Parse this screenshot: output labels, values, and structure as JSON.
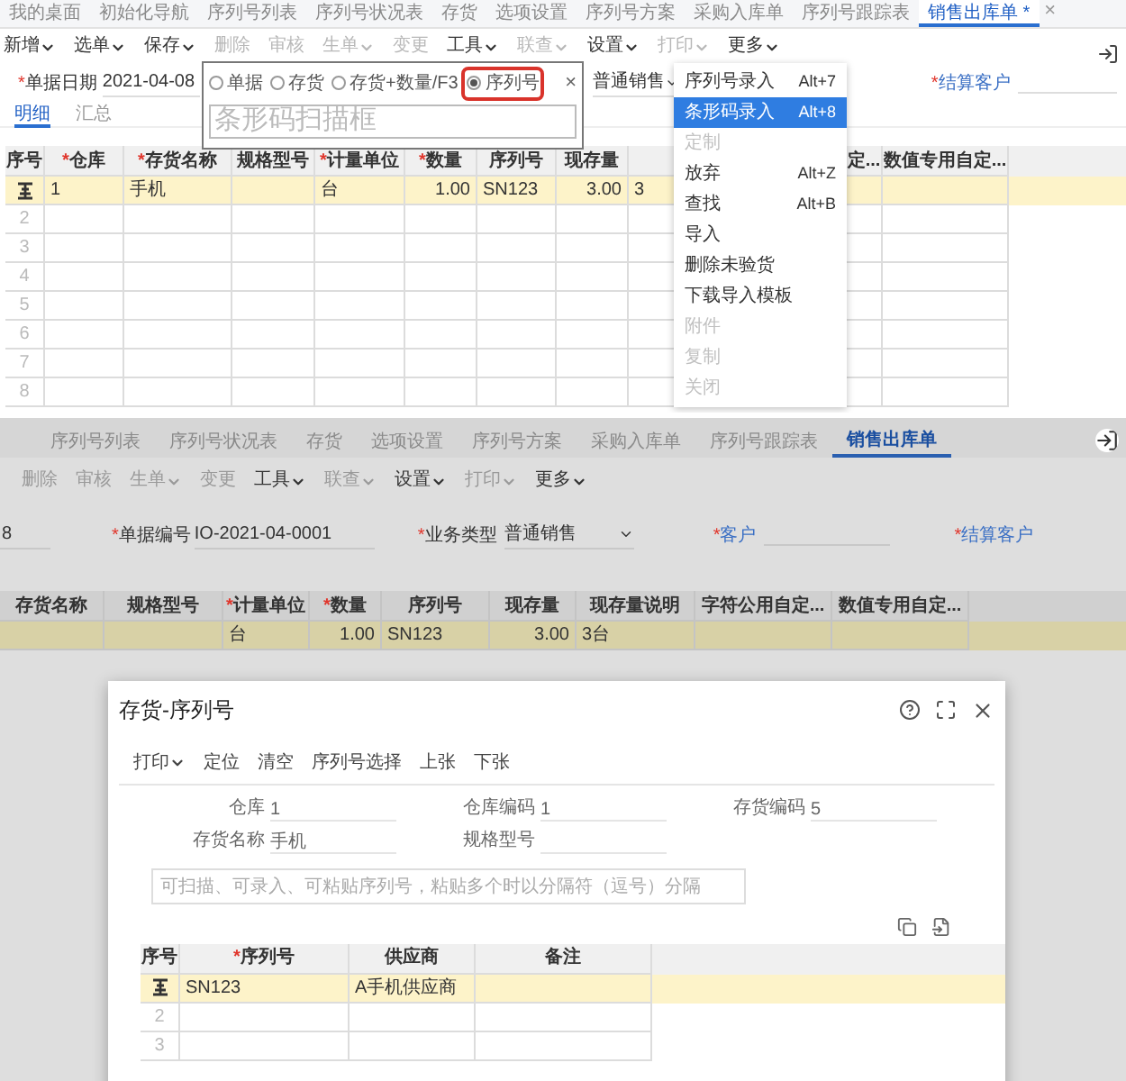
{
  "top": {
    "tabs": [
      {
        "label": "我的桌面",
        "selected": false
      },
      {
        "label": "初始化导航",
        "selected": false
      },
      {
        "label": "序列号列表",
        "selected": false
      },
      {
        "label": "序列号状况表",
        "selected": false
      },
      {
        "label": "存货",
        "selected": false
      },
      {
        "label": "选项设置",
        "selected": false
      },
      {
        "label": "序列号方案",
        "selected": false
      },
      {
        "label": "采购入库单",
        "selected": false
      },
      {
        "label": "序列号跟踪表",
        "selected": false
      },
      {
        "label": "销售出库单 *",
        "selected": true
      }
    ],
    "tab_close": "×",
    "toolbar": [
      {
        "label": "新增",
        "dropdown": true,
        "disabled": false
      },
      {
        "label": "选单",
        "dropdown": true,
        "disabled": false
      },
      {
        "label": "保存",
        "dropdown": true,
        "disabled": false
      },
      {
        "label": "删除",
        "dropdown": false,
        "disabled": true
      },
      {
        "label": "审核",
        "dropdown": false,
        "disabled": true
      },
      {
        "label": "生单",
        "dropdown": true,
        "disabled": true
      },
      {
        "label": "变更",
        "dropdown": false,
        "disabled": true
      },
      {
        "label": "工具",
        "dropdown": true,
        "disabled": false
      },
      {
        "label": "联查",
        "dropdown": true,
        "disabled": true
      },
      {
        "label": "设置",
        "dropdown": true,
        "disabled": false
      },
      {
        "label": "打印",
        "dropdown": true,
        "disabled": true
      },
      {
        "label": "更多",
        "dropdown": true,
        "disabled": false
      }
    ],
    "form": {
      "date_mark": "*",
      "date_label": "单据日期",
      "date_value": "2021-04-08",
      "business_type": "普通销售",
      "customer_mark": "*",
      "customer_label": "结算客户"
    },
    "subtabs": [
      {
        "label": "明细",
        "selected": true
      },
      {
        "label": "汇总",
        "selected": false
      }
    ],
    "table": {
      "columns": [
        {
          "label": "序号"
        },
        {
          "label": "仓库",
          "required_mark": "*"
        },
        {
          "label": "存货名称",
          "required_mark": "*"
        },
        {
          "label": "规格型号"
        },
        {
          "label": "计量单位",
          "required_mark": "*"
        },
        {
          "label": "数量",
          "required_mark": "*"
        },
        {
          "label": "序列号"
        },
        {
          "label": "现存量"
        },
        {},
        {
          "label": "定..."
        },
        {
          "label": "数值专用自定..."
        }
      ],
      "rows": [
        {
          "selected": true,
          "cells": [
            "",
            "1",
            "手机",
            "",
            "台",
            "1.00",
            "SN123",
            "3.00",
            "3",
            "",
            ""
          ]
        },
        {
          "selected": false,
          "cells": [
            "2"
          ]
        },
        {
          "selected": false,
          "cells": [
            "3"
          ]
        },
        {
          "selected": false,
          "cells": [
            "4"
          ]
        },
        {
          "selected": false,
          "cells": [
            "5"
          ]
        },
        {
          "selected": false,
          "cells": [
            "6"
          ]
        },
        {
          "selected": false,
          "cells": [
            "7"
          ]
        },
        {
          "selected": false,
          "cells": [
            "8"
          ]
        }
      ]
    },
    "scan_popup": {
      "modes": [
        {
          "label": "单据",
          "selected": false
        },
        {
          "label": "存货",
          "selected": false
        },
        {
          "label": "存货+数量/F3",
          "selected": false
        },
        {
          "label": "序列号",
          "selected": true
        }
      ],
      "close": "×",
      "placeholder": "条形码扫描框"
    },
    "menu": [
      {
        "label": "序列号录入",
        "shortcut": "Alt+7",
        "highlighted": false,
        "disabled": false
      },
      {
        "label": "条形码录入",
        "shortcut": "Alt+8",
        "highlighted": true,
        "disabled": false
      },
      {
        "label": "定制",
        "highlighted": false,
        "disabled": true
      },
      {
        "label": "放弃",
        "shortcut": "Alt+Z",
        "highlighted": false,
        "disabled": false
      },
      {
        "label": "查找",
        "shortcut": "Alt+B",
        "highlighted": false,
        "disabled": false
      },
      {
        "label": "导入",
        "highlighted": false,
        "disabled": false
      },
      {
        "label": "删除未验货",
        "highlighted": false,
        "disabled": false
      },
      {
        "label": "下载导入模板",
        "highlighted": false,
        "disabled": false
      },
      {
        "label": "附件",
        "highlighted": false,
        "disabled": true
      },
      {
        "label": "复制",
        "highlighted": false,
        "disabled": true
      },
      {
        "label": "关闭",
        "highlighted": false,
        "disabled": true
      }
    ]
  },
  "bottom": {
    "tabs": [
      {
        "label": "序列号列表",
        "selected": false
      },
      {
        "label": "序列号状况表",
        "selected": false
      },
      {
        "label": "存货",
        "selected": false
      },
      {
        "label": "选项设置",
        "selected": false
      },
      {
        "label": "序列号方案",
        "selected": false
      },
      {
        "label": "采购入库单",
        "selected": false
      },
      {
        "label": "序列号跟踪表",
        "selected": false
      },
      {
        "label": "销售出库单",
        "selected": true
      }
    ],
    "toolbar": [
      {
        "label": "删除",
        "dropdown": false,
        "disabled": true
      },
      {
        "label": "审核",
        "dropdown": false,
        "disabled": true
      },
      {
        "label": "生单",
        "dropdown": true,
        "disabled": true
      },
      {
        "label": "变更",
        "dropdown": false,
        "disabled": true
      },
      {
        "label": "工具",
        "dropdown": true,
        "disabled": false
      },
      {
        "label": "联查",
        "dropdown": true,
        "disabled": true
      },
      {
        "label": "设置",
        "dropdown": true,
        "disabled": false
      },
      {
        "label": "打印",
        "dropdown": true,
        "disabled": true
      },
      {
        "label": "更多",
        "dropdown": true,
        "disabled": false
      }
    ],
    "form": {
      "date_value": "8",
      "number_mark": "*",
      "number_label": "单据编号",
      "number_value": "IO-2021-04-0001",
      "type_mark": "*",
      "type_label": "业务类型",
      "type_value": "普通销售",
      "customer_mark": "*",
      "customer_label": "客户",
      "settle_mark": "*",
      "settle_label": "结算客户"
    },
    "table": {
      "columns": [
        {
          "label": "存货名称"
        },
        {
          "label": "规格型号"
        },
        {
          "label": "计量单位",
          "required_mark": "*"
        },
        {
          "label": "数量",
          "required_mark": "*"
        },
        {
          "label": "序列号"
        },
        {
          "label": "现存量"
        },
        {
          "label": "现存量说明"
        },
        {
          "label": "字符公用自定..."
        },
        {
          "label": "数值专用自定..."
        }
      ],
      "rows": [
        {
          "selected": true,
          "cells": [
            "",
            "",
            "台",
            "1.00",
            "SN123",
            "3.00",
            "3台",
            "",
            ""
          ]
        }
      ]
    },
    "dialog": {
      "title": "存货-序列号",
      "toolbar": [
        {
          "label": "打印",
          "dropdown": true
        },
        {
          "label": "定位",
          "dropdown": false
        },
        {
          "label": "清空",
          "dropdown": false
        },
        {
          "label": "序列号选择",
          "dropdown": false
        },
        {
          "label": "上张",
          "dropdown": false
        },
        {
          "label": "下张",
          "dropdown": false
        }
      ],
      "fields": [
        {
          "label": "仓库",
          "value": "1"
        },
        {
          "label": "仓库编码",
          "value": "1"
        },
        {
          "label": "存货编码",
          "value": "5"
        },
        {
          "label": "存货名称",
          "value": "手机"
        },
        {
          "label": "规格型号"
        }
      ],
      "input_placeholder": "可扫描、可录入、可粘贴序列号，粘贴多个时以分隔符（逗号）分隔",
      "table": {
        "columns": [
          {
            "label": "序号"
          },
          {
            "label": "序列号",
            "required_mark": "*"
          },
          {
            "label": "供应商"
          },
          {
            "label": "备注"
          }
        ],
        "rows": [
          {
            "selected": true,
            "cells": [
              "",
              "SN123",
              "A手机供应商",
              ""
            ]
          },
          {
            "selected": false,
            "cells": [
              "2"
            ]
          },
          {
            "selected": false,
            "cells": [
              "3"
            ]
          }
        ]
      }
    }
  }
}
